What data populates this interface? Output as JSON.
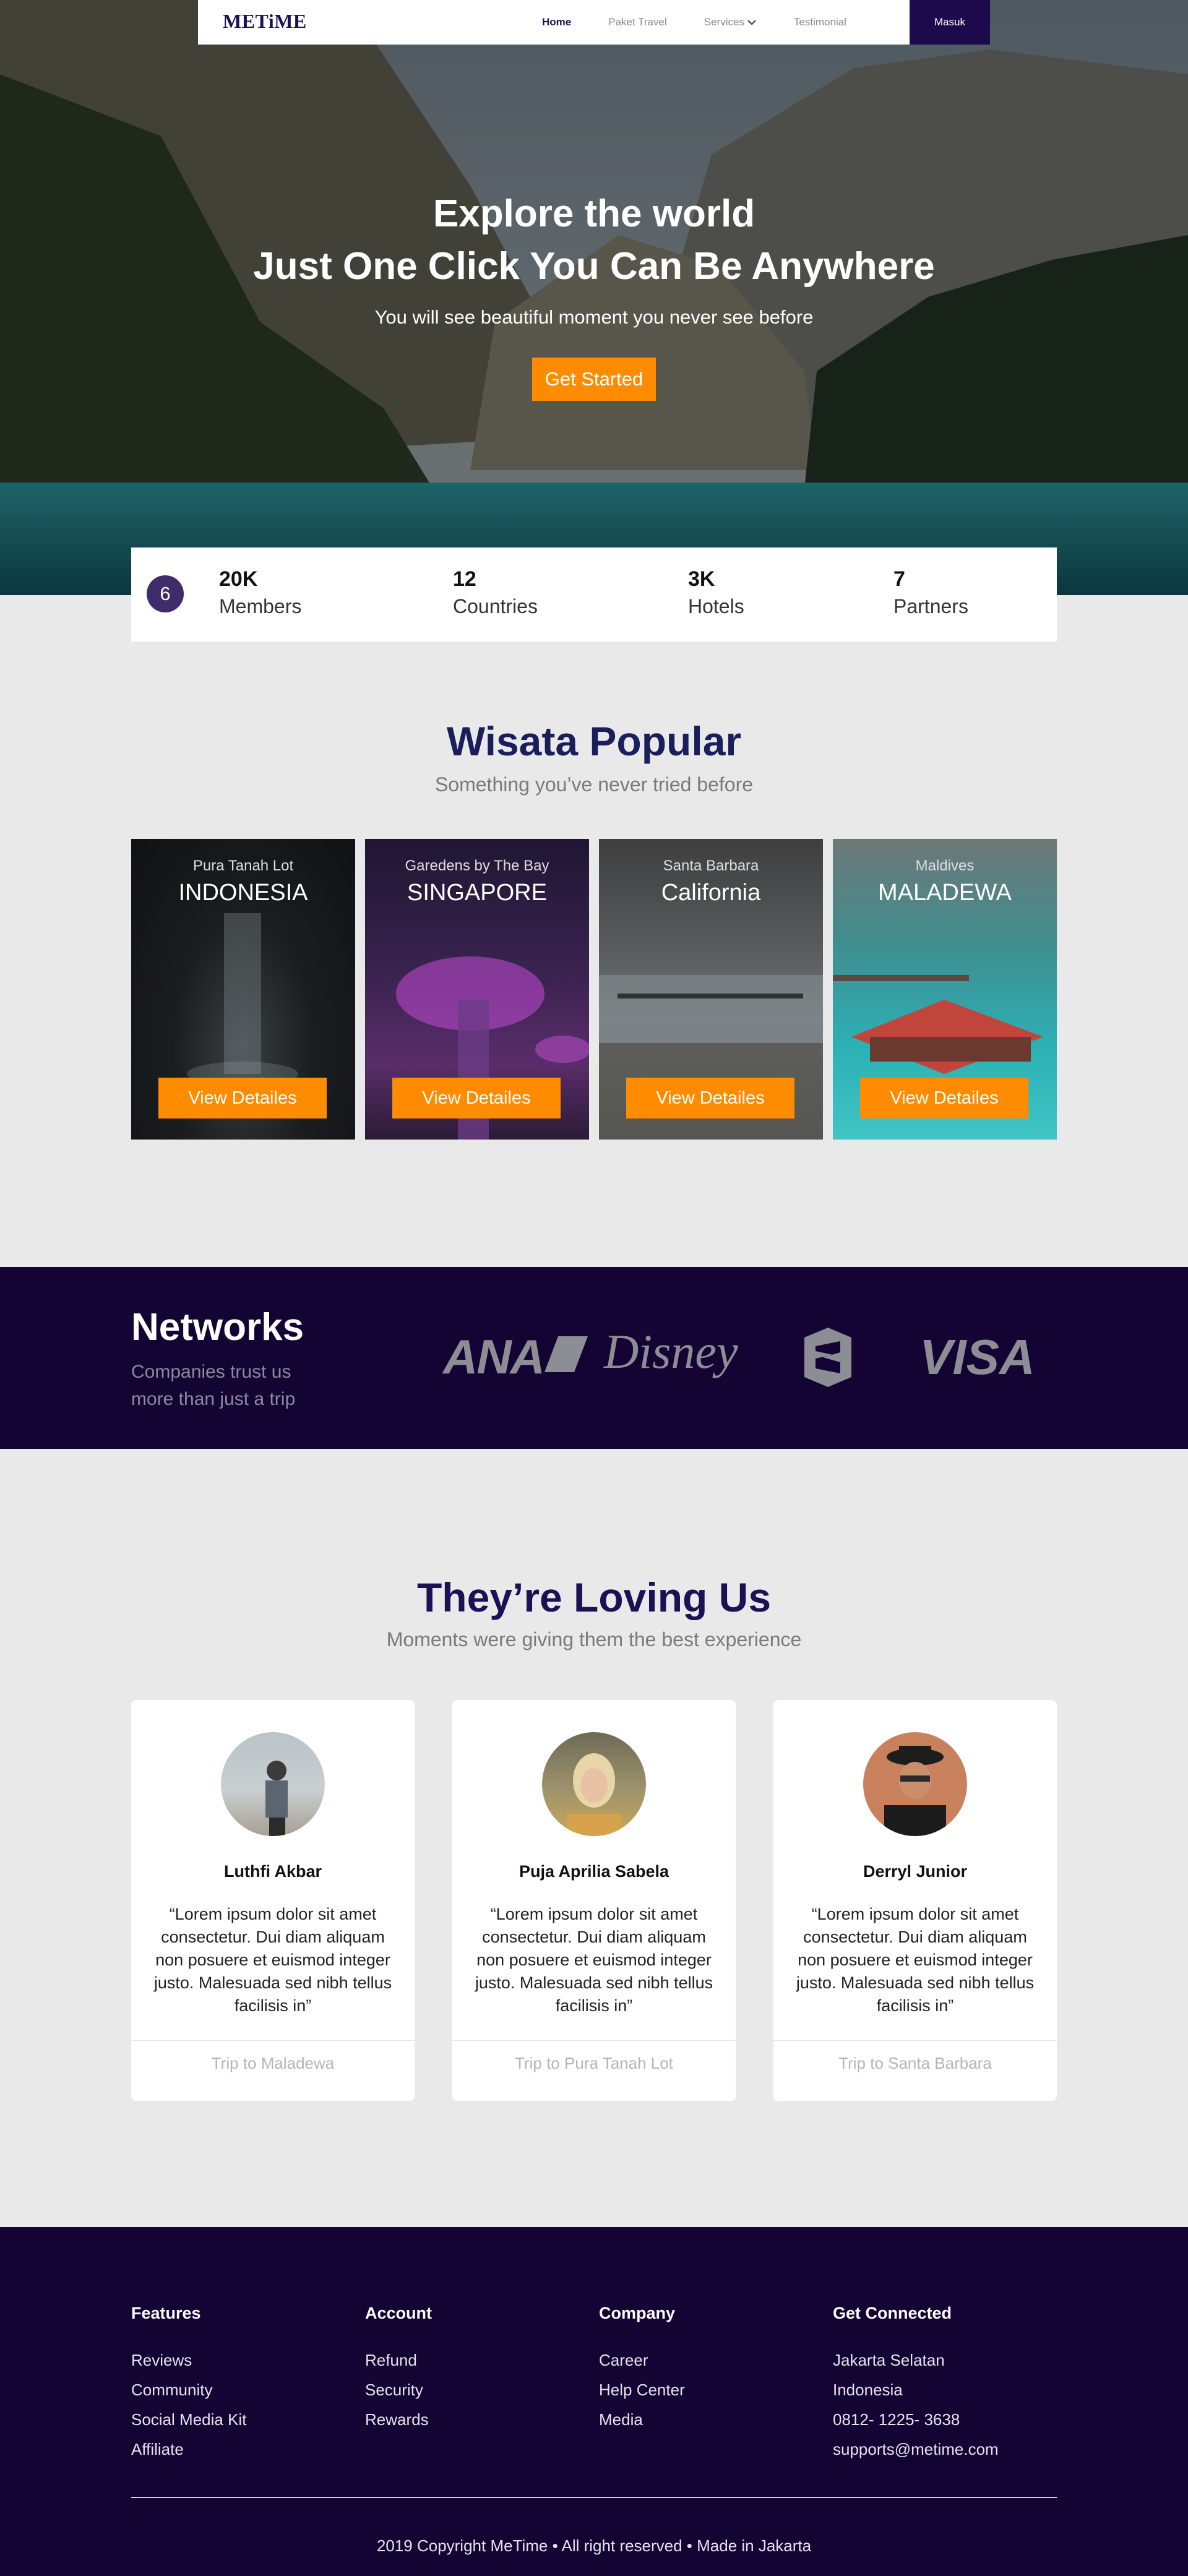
{
  "navbar": {
    "logo": "METiME",
    "links": [
      "Home",
      "Paket Travel",
      "Services",
      "Testimonial"
    ],
    "login_label": "Masuk"
  },
  "hero": {
    "line1": "Explore the world",
    "line2": "Just One Click You Can Be Anywhere",
    "subtitle": "You will see beautiful moment you never see before",
    "cta_label": "Get Started"
  },
  "stats": {
    "badge": "6",
    "items": [
      {
        "value": "20K",
        "label": "Members"
      },
      {
        "value": "12",
        "label": "Countries"
      },
      {
        "value": "3K",
        "label": "Hotels"
      },
      {
        "value": "7",
        "label": "Partners"
      }
    ]
  },
  "popular": {
    "title": "Wisata Popular",
    "subtitle": "Something you’ve never tried before",
    "cards": [
      {
        "place": "Pura Tanah Lot",
        "country": "INDONESIA",
        "button": "View Detailes"
      },
      {
        "place": "Garedens by The Bay",
        "country": "SINGAPORE",
        "button": "View Detailes"
      },
      {
        "place": "Santa Barbara",
        "country": "California",
        "button": "View Detailes"
      },
      {
        "place": "Maldives",
        "country": "MALADEWA",
        "button": "View Detailes"
      }
    ]
  },
  "networks": {
    "title": "Networks",
    "subtitle_line1": "Companies trust us",
    "subtitle_line2": "more than just a trip",
    "brands": [
      "ANA",
      "Disney",
      "VISA"
    ]
  },
  "testimonials": {
    "title": "They’re Loving Us",
    "subtitle": "Moments were giving them the best experience",
    "items": [
      {
        "name": "Luthfi Akbar",
        "quote": "“Lorem ipsum dolor sit amet consectetur. Dui diam aliquam non posuere et euismod integer justo. Malesuada sed nibh tellus facilisis in”",
        "trip": "Trip to Maladewa"
      },
      {
        "name": "Puja Aprilia Sabela",
        "quote": "“Lorem ipsum dolor sit amet consectetur. Dui diam aliquam non posuere et euismod integer justo. Malesuada sed nibh tellus facilisis in”",
        "trip": "Trip to Pura Tanah Lot"
      },
      {
        "name": "Derryl Junior",
        "quote": "“Lorem ipsum dolor sit amet consectetur. Dui diam aliquam non posuere et euismod integer justo. Malesuada sed nibh tellus facilisis in”",
        "trip": "Trip to Santa Barbara"
      }
    ]
  },
  "footer": {
    "columns": [
      {
        "heading": "Features",
        "items": [
          "Reviews",
          "Community",
          "Social Media Kit",
          "Affiliate"
        ]
      },
      {
        "heading": "Account",
        "items": [
          "Refund",
          "Security",
          "Rewards"
        ]
      },
      {
        "heading": "Company",
        "items": [
          "Career",
          "Help Center",
          "Media"
        ]
      },
      {
        "heading": "Get Connected",
        "items": [
          "Jakarta Selatan",
          "Indonesia",
          "0812- 1225- 3638",
          "supports@metime.com"
        ]
      }
    ],
    "copyright": "2019 Copyright MeTime • All right reserved • Made in Jakarta"
  },
  "colors": {
    "brand_dark": "#130434",
    "accent": "#ff8c00",
    "title_blue": "#1a1f5c"
  }
}
